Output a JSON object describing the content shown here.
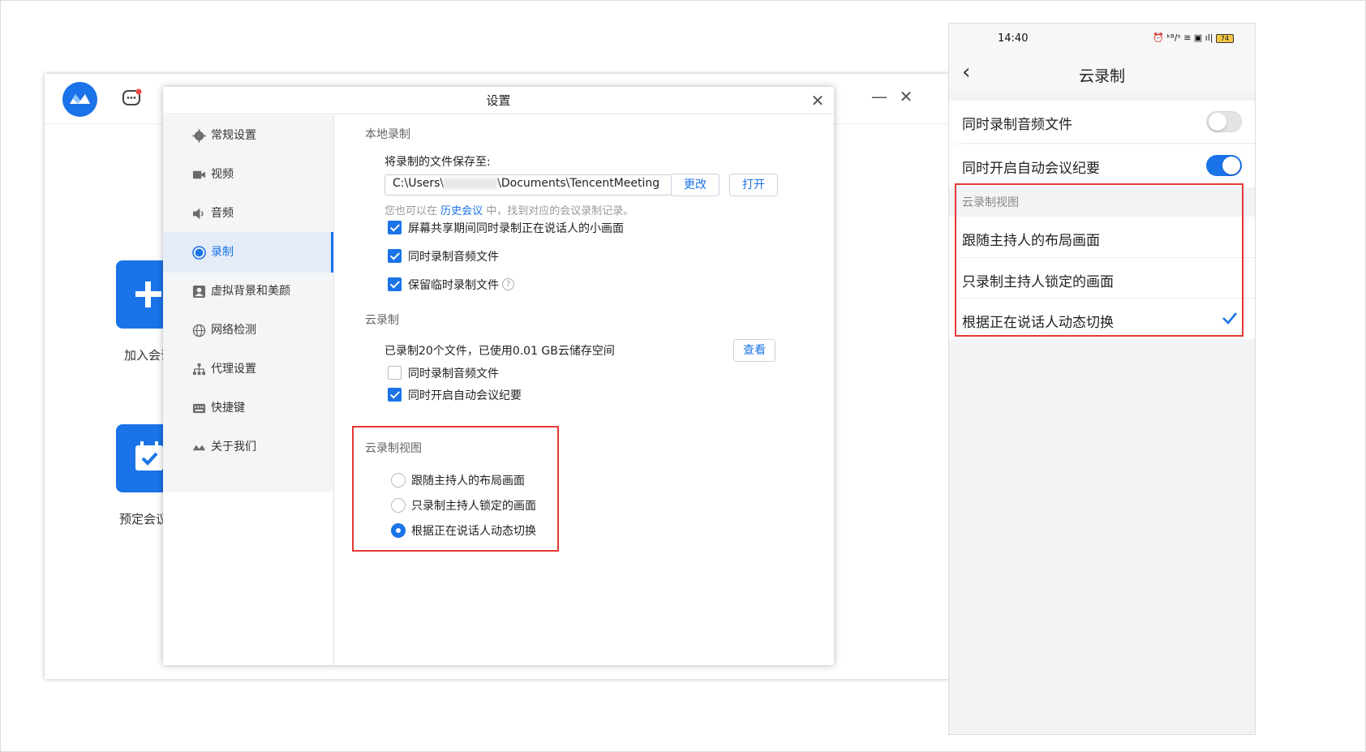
{
  "main_window": {
    "join_label": "加入会议",
    "schedule_label": "预定会议",
    "minimize": "—",
    "close": "✕"
  },
  "dialog": {
    "title": "设置",
    "close": "✕",
    "nav": [
      {
        "label": "常规设置",
        "icon": "gear-icon"
      },
      {
        "label": "视频",
        "icon": "video-icon"
      },
      {
        "label": "音频",
        "icon": "speaker-icon"
      },
      {
        "label": "录制",
        "icon": "record-icon",
        "active": true
      },
      {
        "label": "虚拟背景和美颜",
        "icon": "portrait-icon"
      },
      {
        "label": "网络检测",
        "icon": "globe-icon"
      },
      {
        "label": "代理设置",
        "icon": "network-icon"
      },
      {
        "label": "快捷键",
        "icon": "keyboard-icon"
      },
      {
        "label": "关于我们",
        "icon": "logo-icon"
      }
    ],
    "local": {
      "section_title": "本地录制",
      "save_to_label": "将录制的文件保存至:",
      "path_prefix": "C:\\Users\\",
      "path_suffix": "\\Documents\\TencentMeeting",
      "change_button": "更改",
      "open_button": "打开",
      "hint_before": "您也可以在 ",
      "hint_link": "历史会议",
      "hint_after": " 中，找到对应的会议录制记录。",
      "options": [
        {
          "label": "屏幕共享期间同时录制正在说话人的小画面",
          "checked": true
        },
        {
          "label": "同时录制音频文件",
          "checked": true
        },
        {
          "label": "保留临时录制文件",
          "checked": true
        }
      ],
      "help_glyph": "?"
    },
    "cloud": {
      "section_title": "云录制",
      "usage_text": "已录制20个文件，已使用0.01 GB云储存空间",
      "view_button": "查看",
      "options": [
        {
          "label": "同时录制音频文件",
          "checked": false
        },
        {
          "label": "同时开启自动会议纪要",
          "checked": true
        }
      ]
    },
    "cloud_view": {
      "section_title": "云录制视图",
      "options": [
        {
          "label": "跟随主持人的布局画面",
          "selected": false
        },
        {
          "label": "只录制主持人锁定的画面",
          "selected": false
        },
        {
          "label": "根据正在说话人动态切换",
          "selected": true
        }
      ]
    }
  },
  "phone": {
    "time": "14:40",
    "status_icons": "⏰ ᵏᴮ/ˢ ≋ ▣ ıl|",
    "battery": "74",
    "back_glyph": "‹",
    "title": "云录制",
    "toggles": [
      {
        "label": "同时录制音频文件",
        "on": false
      },
      {
        "label": "同时开启自动会议纪要",
        "on": true
      }
    ],
    "group_title": "云录制视图",
    "options": [
      {
        "label": "跟随主持人的布局画面",
        "selected": false
      },
      {
        "label": "只录制主持人锁定的画面",
        "selected": false
      },
      {
        "label": "根据正在说话人动态切换",
        "selected": true
      }
    ]
  },
  "colors": {
    "accent": "#1a73e8",
    "highlight_box": "#e53935"
  }
}
